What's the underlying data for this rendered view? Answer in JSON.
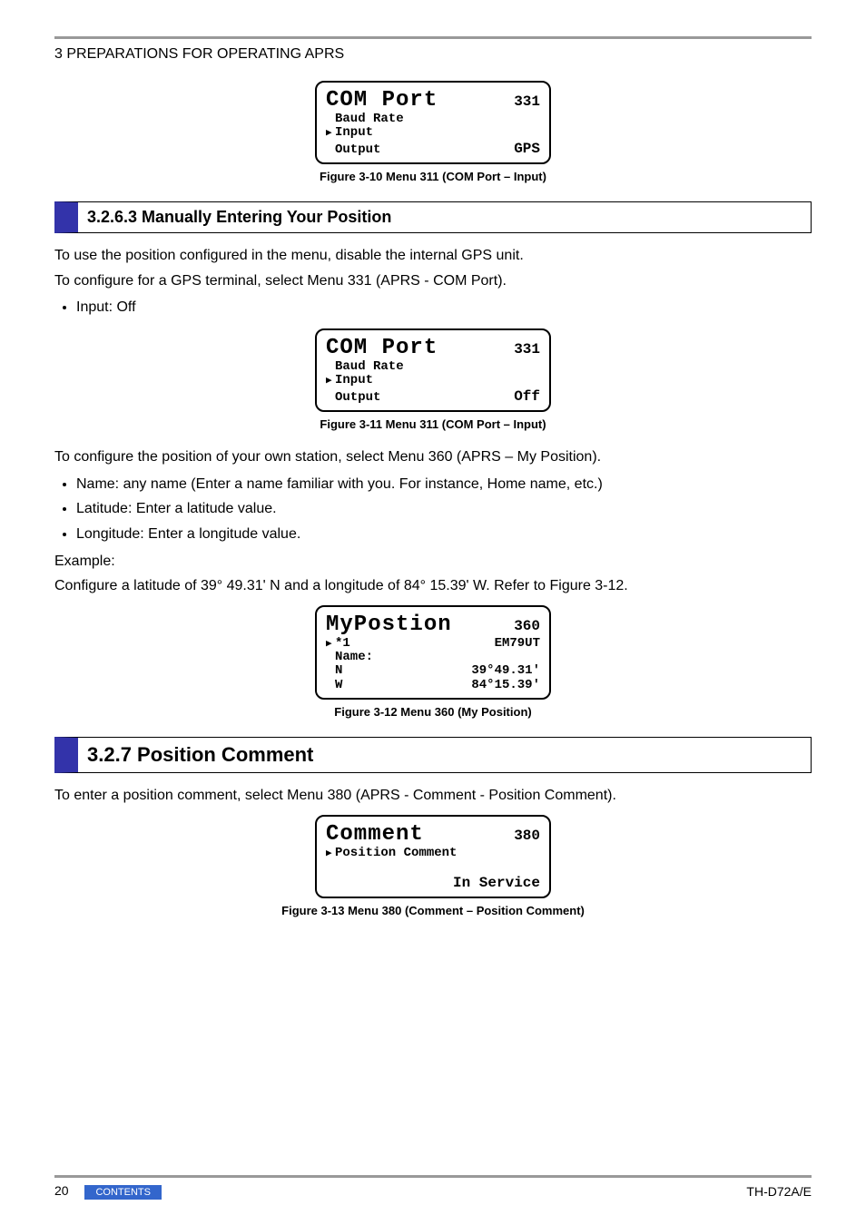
{
  "breadcrumb": "3 PREPARATIONS FOR OPERATING APRS",
  "fig310": {
    "title": "COM Port",
    "num": "331",
    "l1": "Baud Rate",
    "l2": "Input",
    "l3": "Output",
    "status": "GPS",
    "caption": "Figure 3-10  Menu 311 (COM Port – Input)"
  },
  "sec3263": {
    "heading": "3.2.6.3  Manually Entering Your Position",
    "p1": "To use the position configured in the menu, disable the internal GPS unit.",
    "p2": "To configure for a GPS terminal, select Menu 331 (APRS - COM Port).",
    "li1": "Input: Off"
  },
  "fig311": {
    "title": "COM Port",
    "num": "331",
    "l1": "Baud Rate",
    "l2": "Input",
    "l3": "Output",
    "status": "Off",
    "caption": "Figure 3-11  Menu 311 (COM Port – Input)"
  },
  "mypos": {
    "p1": "To configure the position of your own station, select Menu 360 (APRS – My Position).",
    "li1": "Name: any name (Enter a name familiar with you.  For instance, Home name, etc.)",
    "li2": "Latitude: Enter a latitude value.",
    "li3": "Longitude: Enter a longitude value.",
    "p2": "Example:",
    "p3": "Configure a latitude of 39° 49.31' N and a longitude of 84° 15.39' W.  Refer to Figure 3-12."
  },
  "fig312": {
    "title": "MyPostion",
    "num": "360",
    "l1a": "*1",
    "l1b": "EM79UT",
    "l2": "Name:",
    "l3a": "N",
    "l3b": "39°49.31'",
    "l4a": "W",
    "l4b": "84°15.39'",
    "caption": "Figure 3-12  Menu 360 (My Position)"
  },
  "sec327": {
    "heading": "3.2.7  Position Comment",
    "p1": "To enter a position comment, select Menu 380 (APRS - Comment - Position Comment)."
  },
  "fig313": {
    "title": "Comment",
    "num": "380",
    "l1": "Position Comment",
    "status": "In Service",
    "caption": "Figure 3-13  Menu 380 (Comment – Position Comment)"
  },
  "footer": {
    "page": "20",
    "contents": "CONTENTS",
    "model": "TH-D72A/E"
  }
}
